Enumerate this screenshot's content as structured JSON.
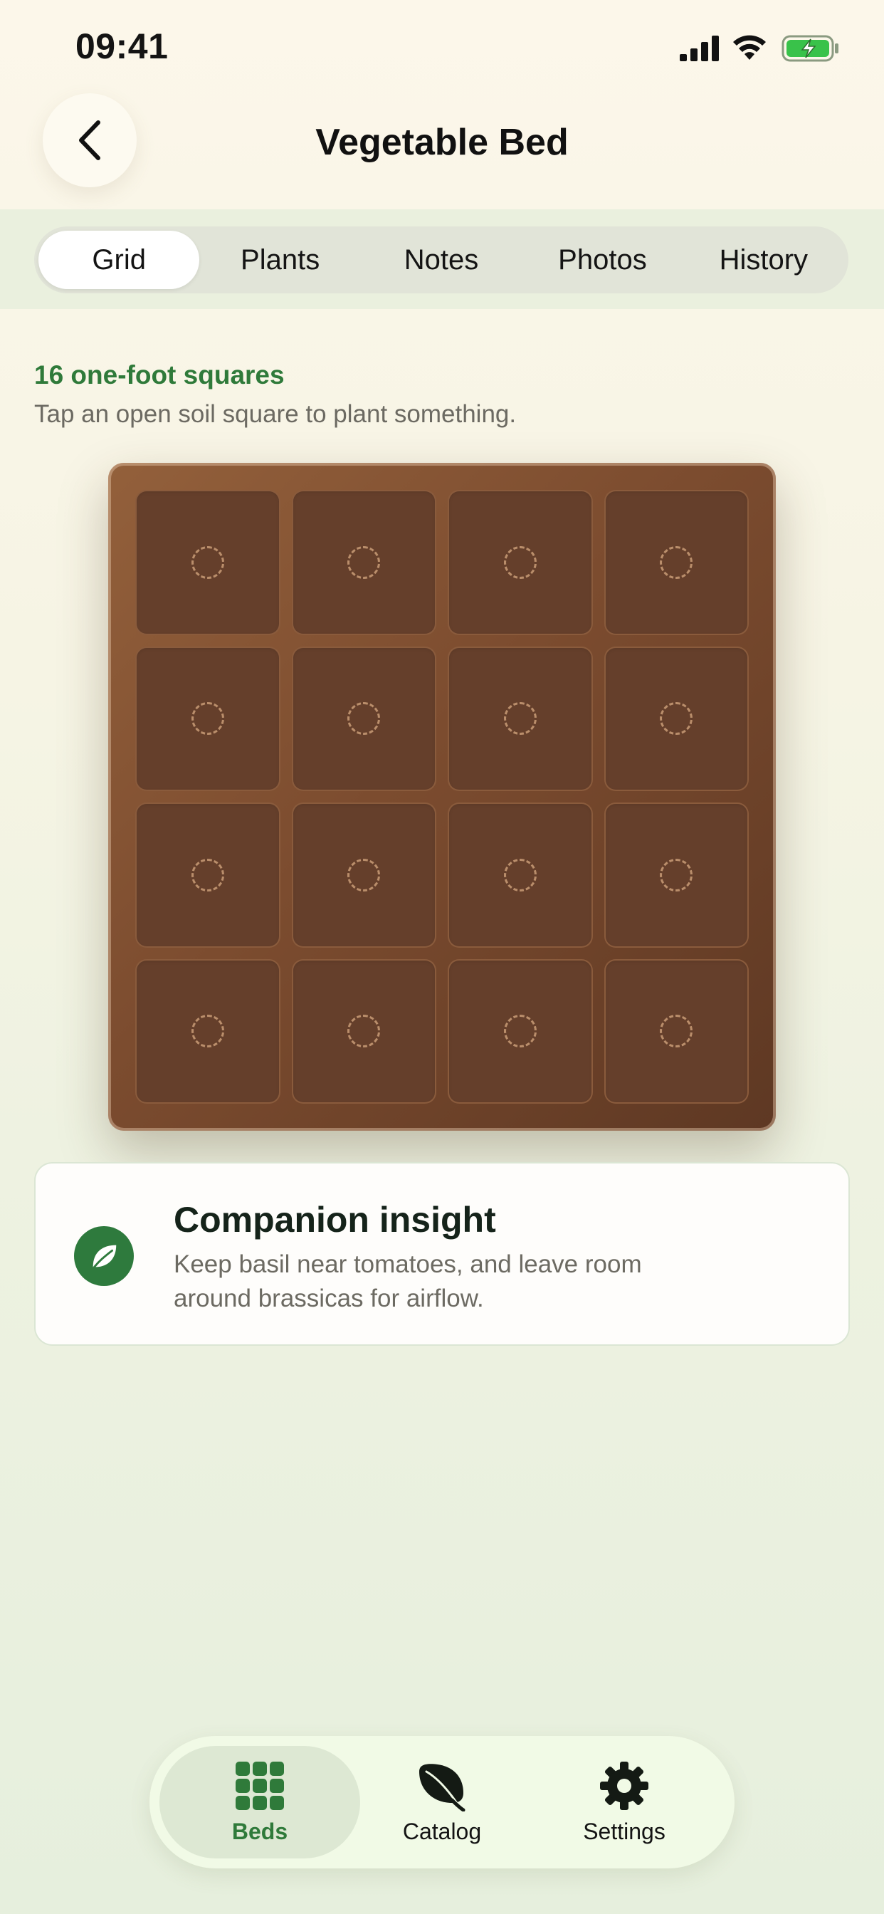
{
  "status_bar": {
    "time": "09:41"
  },
  "header": {
    "title": "Vegetable Bed"
  },
  "tabs": [
    {
      "label": "Grid",
      "active": true
    },
    {
      "label": "Plants",
      "active": false
    },
    {
      "label": "Notes",
      "active": false
    },
    {
      "label": "Photos",
      "active": false
    },
    {
      "label": "History",
      "active": false
    }
  ],
  "summary": {
    "title": "16 one-foot squares",
    "hint": "Tap an open soil square to plant something."
  },
  "bed": {
    "rows": 4,
    "columns": 4,
    "square_state": "open"
  },
  "insight": {
    "icon": "leaf-icon",
    "title": "Companion insight",
    "body": "Keep basil near tomatoes, and leave room around brassicas for airflow."
  },
  "bottom_nav": [
    {
      "label": "Beds",
      "icon": "grid-icon",
      "active": true
    },
    {
      "label": "Catalog",
      "icon": "leaf-icon",
      "active": false
    },
    {
      "label": "Settings",
      "icon": "gear-icon",
      "active": false
    }
  ],
  "colors": {
    "accent_green": "#2f7a3a",
    "soil": "#653f2b",
    "bed_frame": "#7c4c2f"
  }
}
